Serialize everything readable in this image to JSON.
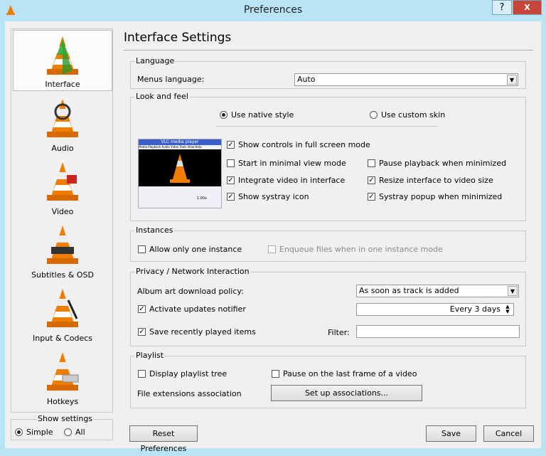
{
  "window": {
    "title": "Preferences",
    "help": "?",
    "close": "X"
  },
  "sidebar": {
    "items": [
      {
        "label": "Interface",
        "icon": "interface-cone-icon"
      },
      {
        "label": "Audio",
        "icon": "audio-cone-icon"
      },
      {
        "label": "Video",
        "icon": "video-cone-icon"
      },
      {
        "label": "Subtitles & OSD",
        "icon": "subtitles-cone-icon"
      },
      {
        "label": "Input & Codecs",
        "icon": "input-cone-icon"
      },
      {
        "label": "Hotkeys",
        "icon": "hotkeys-cone-icon"
      }
    ],
    "show_settings": {
      "label": "Show settings",
      "simple": "Simple",
      "all": "All",
      "selected": "Simple"
    }
  },
  "main": {
    "title": "Interface Settings",
    "language": {
      "label": "Language",
      "menus_language_label": "Menus language:",
      "menus_language_value": "Auto"
    },
    "look": {
      "label": "Look and feel",
      "native": "Use native style",
      "custom": "Use custom skin",
      "selected": "native",
      "preview_title": "VLC media player",
      "preview_menu": "Media Playback Audio Video Tools View Help",
      "preview_time": "1.00x",
      "options": [
        {
          "label": "Show controls in full screen mode",
          "checked": true
        },
        {
          "label": "Start in minimal view mode",
          "checked": false
        },
        {
          "label": "Pause playback when minimized",
          "checked": false
        },
        {
          "label": "Integrate video in interface",
          "checked": true
        },
        {
          "label": "Resize interface to video size",
          "checked": true
        },
        {
          "label": "Show systray icon",
          "checked": true
        },
        {
          "label": "Systray popup when minimized",
          "checked": true
        }
      ]
    },
    "instances": {
      "label": "Instances",
      "one": "Allow only one instance",
      "one_checked": false,
      "enqueue": "Enqueue files when in one instance mode",
      "enqueue_checked": false
    },
    "privacy": {
      "label": "Privacy / Network Interaction",
      "album_label": "Album art download policy:",
      "album_value": "As soon as track is added",
      "updates": "Activate updates notifier",
      "updates_checked": true,
      "updates_value": "Every 3 days",
      "recent": "Save recently played items",
      "recent_checked": true,
      "filter_label": "Filter:",
      "filter_value": ""
    },
    "playlist": {
      "label": "Playlist",
      "tree": "Display playlist tree",
      "tree_checked": false,
      "pause": "Pause on the last frame of a video",
      "pause_checked": false,
      "assoc_label": "File extensions association",
      "assoc_button": "Set up associations..."
    }
  },
  "footer": {
    "reset": "Reset Preferences",
    "save": "Save",
    "cancel": "Cancel"
  },
  "colors": {
    "titlebar": "#b9e4f6",
    "close": "#c7463c",
    "cone": "#f07d00"
  }
}
